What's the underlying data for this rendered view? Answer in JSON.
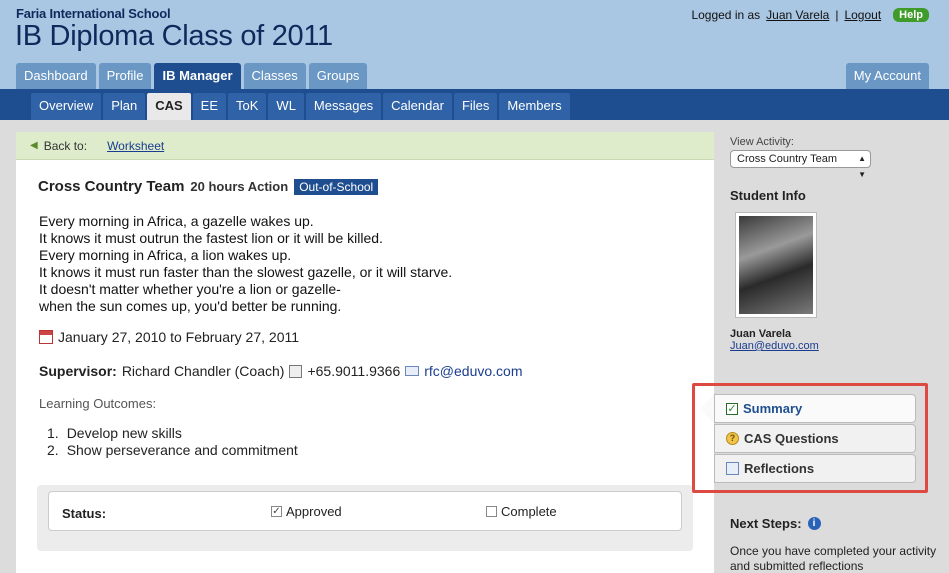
{
  "header": {
    "school": "Faria International School",
    "class_title": "IB Diploma Class of 2011",
    "logged_in_as": "Logged in as",
    "user": "Juan Varela",
    "logout": "Logout",
    "help": "Help"
  },
  "tabs": [
    "Dashboard",
    "Profile",
    "IB Manager",
    "Classes",
    "Groups"
  ],
  "active_tab": "IB Manager",
  "my_account": "My Account",
  "subtabs": [
    "Overview",
    "Plan",
    "CAS",
    "EE",
    "ToK",
    "WL",
    "Messages",
    "Calendar",
    "Files",
    "Members"
  ],
  "active_subtab": "CAS",
  "back": {
    "label": "Back to:",
    "link": "Worksheet"
  },
  "activity": {
    "name": "Cross Country Team",
    "hours": "20 hours Action",
    "badge": "Out-of-School",
    "description": [
      "Every morning in Africa, a gazelle wakes up.",
      "It knows it must outrun the fastest lion or it will be killed.",
      "Every morning in Africa, a lion wakes up.",
      "It knows it must run faster than the slowest gazelle, or it will starve.",
      "It doesn't matter whether you're a lion or gazelle-",
      "when the sun comes up, you'd better be running."
    ],
    "dates": "January 27, 2010 to February 27, 2011",
    "supervisor_label": "Supervisor:",
    "supervisor": "Richard Chandler (Coach)",
    "phone": "+65.9011.9366",
    "email": "rfc@eduvo.com",
    "learning_outcomes_label": "Learning Outcomes:",
    "learning_outcomes": [
      "Develop new skills",
      "Show perseverance and commitment"
    ]
  },
  "status": {
    "label": "Status:",
    "approved": {
      "label": "Approved",
      "checked": true
    },
    "complete": {
      "label": "Complete",
      "checked": false
    }
  },
  "sidebar": {
    "view_activity_label": "View Activity:",
    "view_activity_value": "Cross Country Team",
    "student_info_title": "Student Info",
    "student_name": "Juan Varela",
    "student_email": "Juan@eduvo.com",
    "tabs": [
      "Summary",
      "CAS Questions",
      "Reflections"
    ],
    "next_steps_title": "Next Steps:",
    "next_steps_text": "Once you have completed your activity and submitted reflections"
  },
  "colors": {
    "header_bg": "#a9c6e2",
    "nav_dark": "#1e4e90",
    "highlight_box": "#dd4a41"
  }
}
